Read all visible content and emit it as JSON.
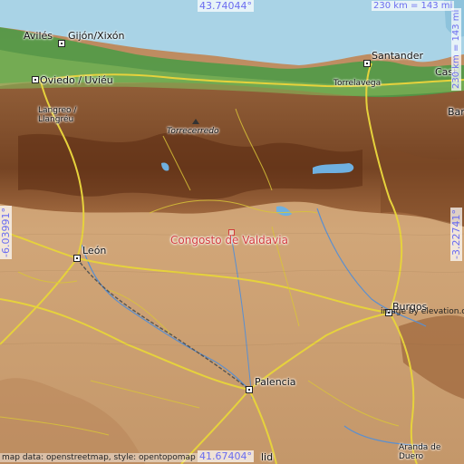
{
  "map": {
    "coords": {
      "top": "43.74044°",
      "bottom": "41.67404°",
      "left": "-6.03991°",
      "right": "-3.22741°"
    },
    "scale": {
      "top": "230 km = 143 mi",
      "right": "230 km = 143 mi"
    },
    "target": {
      "name": "Congosto de Valdavia"
    },
    "places": [
      {
        "id": "aviles",
        "label": "Avilés"
      },
      {
        "id": "gijon",
        "label": "Gijón/Xixón"
      },
      {
        "id": "oviedo",
        "label": "Oviedo / Uviéu"
      },
      {
        "id": "santander",
        "label": "Santander"
      },
      {
        "id": "torrelavega",
        "label": "Torrelavega"
      },
      {
        "id": "castro",
        "label": "Cast"
      },
      {
        "id": "bar",
        "label": "Bar"
      },
      {
        "id": "langreo1",
        "label": "Langreo /"
      },
      {
        "id": "langreo2",
        "label": "Llangréu"
      },
      {
        "id": "torrecerredo",
        "label": "Torrecerredo"
      },
      {
        "id": "leon",
        "label": "León"
      },
      {
        "id": "burgos",
        "label": "Burgos"
      },
      {
        "id": "palencia",
        "label": "Palencia"
      },
      {
        "id": "aranda1",
        "label": "Aranda de"
      },
      {
        "id": "aranda2",
        "label": "Duero"
      },
      {
        "id": "valladolid",
        "label": "lid"
      }
    ],
    "credits": {
      "left": "map data: openstreetmap, style: opentopomap",
      "right": "image by elevation.city"
    },
    "colors": {
      "sea": "#a9d3e6",
      "coast_green": "#2f8a3b",
      "mountain_dark": "#7a3f1e",
      "plain": "#c99a6a",
      "road_yellow": "#e6d23c",
      "target": "#d23c3c",
      "coord_text": "#6a6cf0"
    }
  }
}
